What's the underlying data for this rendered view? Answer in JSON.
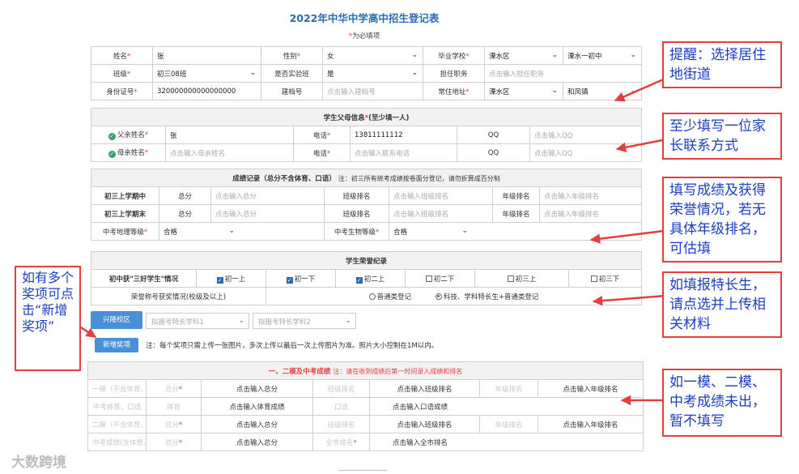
{
  "title": "2022年中华中学高中招生登记表",
  "required_note": "为必填项",
  "basic": {
    "name_label": "姓名",
    "name_value": "张",
    "gender_label": "性别",
    "gender_value": "女",
    "school_label": "毕业学校",
    "school_district": "溧水区",
    "school_name": "溧水一初中",
    "class_label": "班级",
    "class_value": "初三08班",
    "exp_class_label": "是否实验班",
    "exp_class_value": "是",
    "duty_label": "担任职务",
    "duty_placeholder": "点击输入担任职务",
    "id_label": "身份证号",
    "id_value": "320000000000000000",
    "file_label": "建档号",
    "file_placeholder": "点击输入建档号",
    "address_label": "常住地址",
    "address_district": "溧水区",
    "address_street": "和凤镇"
  },
  "parents": {
    "section_title": "学生父母信息",
    "section_note": "(至少填一人)",
    "father_label": "父亲姓名",
    "father_value": "张",
    "phone_label": "电话",
    "father_phone": "13811111112",
    "qq_label": "QQ",
    "qq_placeholder": "点击输入QQ",
    "mother_label": "母亲姓名",
    "mother_placeholder": "点击输入母亲姓名",
    "mother_phone_placeholder": "点击输入联系电话"
  },
  "scores": {
    "section_title": "成绩记录（总分不含体育、口语）",
    "section_note": "注：初三所有统考成绩按卷面分登记，请勿折算成百分制",
    "row1_label": "初三上学期中",
    "row2_label": "初三上学期末",
    "total_label": "总分",
    "total_placeholder": "点击输入总分",
    "class_rank_label": "班级排名",
    "class_rank_placeholder": "点击输入班级排名",
    "grade_rank_label": "年级排名",
    "grade_rank_placeholder": "点击输入年级排名",
    "geo_label": "中考地理等级",
    "geo_value": "合格",
    "bio_label": "中考生物等级",
    "bio_value": "合格"
  },
  "honors": {
    "section_title": "学生荣誉纪录",
    "three_good_label": "初中获\"三好学生\"情况",
    "terms": [
      {
        "label": "初一上",
        "checked": true
      },
      {
        "label": "初一下",
        "checked": true
      },
      {
        "label": "初二上",
        "checked": true
      },
      {
        "label": "初二下",
        "checked": false
      },
      {
        "label": "初三上",
        "checked": false
      },
      {
        "label": "初三下",
        "checked": false
      }
    ],
    "award_label": "荣誉称号获奖情况(校级及以上)",
    "radio1": "普通类登记",
    "radio2": "科技、学科特长生+普通类登记"
  },
  "specialty": {
    "campus_btn": "兴隆校区",
    "dd1": "拟报考特长学科1",
    "dd2": "拟报考特长学科2",
    "add_btn": "新增奖项",
    "add_note": "注：每个奖项只需上传一张图片，多次上传以最后一次上传图片为准。照片大小控制在1M以内。"
  },
  "mock": {
    "section_title": "一、二模及中考成绩",
    "section_note": "注：请在收到成绩后第一时间录入成绩和排名",
    "row1_label": "一模（不含体育、口语）",
    "row2_label": "中考体育、口语",
    "row3_label": "二模（不含体育、口语）",
    "row4_label": "中考成绩(含体育、口语)",
    "total_label": "总分",
    "total_placeholder": "点击输入总分",
    "class_rank_label": "班级排名",
    "class_rank_placeholder": "点击输入班级排名",
    "grade_rank_label": "年级排名",
    "grade_rank_placeholder": "点击输入年级排名",
    "pe_label": "体育",
    "pe_placeholder": "点击输入体育成绩",
    "oral_label": "口语",
    "oral_placeholder": "点击输入口语成绩",
    "city_rank_label": "全市排名",
    "city_rank_placeholder": "点击输入全市排名"
  },
  "callouts": {
    "c1": "提醒：选择居住地街道",
    "c2": "至少填写一位家长联系方式",
    "c3": "填写成绩及获得荣誉情况，若无具体年级排名，可估填",
    "c4": "如填报特长生，请点选并上传相关材料",
    "c5": "如一模、二模、中考成绩未出，暂不填写",
    "c6": "如有多个奖项可点击“新增奖项”"
  },
  "watermark": "大数跨境",
  "colors": {
    "title": "#2b6cb0",
    "required": "#e53e3e",
    "callout_text": "#1a3fbf",
    "callout_border": "#e53e3e",
    "button": "#4a90d9"
  }
}
